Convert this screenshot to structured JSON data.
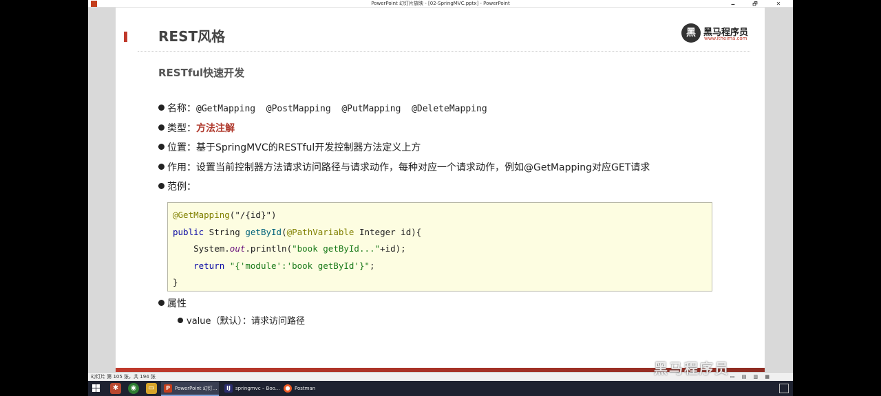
{
  "window": {
    "title": "PowerPoint 幻灯片放映 - [02-SpringMVC.pptx] - PowerPoint",
    "minimize": "🗕",
    "maximize": "🗗",
    "close": "✕"
  },
  "slide": {
    "title": "REST风格",
    "logo": {
      "mark": "黑",
      "text": "黑马程序员",
      "url": "www.itheima.com"
    },
    "subtitle": "RESTful快速开发",
    "bullets": {
      "name_label": "名称：",
      "name_value": "@GetMapping  @PostMapping  @PutMapping  @DeleteMapping",
      "type_label": "类型：",
      "type_value": "方法注解",
      "position_label": "位置：",
      "position_value": "基于SpringMVC的RESTful开发控制器方法定义上方",
      "effect_label": "作用：",
      "effect_value": "设置当前控制器方法请求访问路径与请求动作，每种对应一个请求动作，例如@GetMapping对应GET请求",
      "example_label": "范例："
    },
    "code": {
      "l1_anno": "@GetMapping",
      "l1_rest": "(\"/{id}\")",
      "l2_kw": "public",
      "l2_a": " String ",
      "l2_m": "getById",
      "l2_b": "(",
      "l2_anno": "@PathVariable",
      "l2_c": " Integer id){",
      "l3_a": "    System.",
      "l3_out": "out",
      "l3_b": ".println(",
      "l3_str": "\"book getById...\"",
      "l3_c": "+id);",
      "l4_a": "    ",
      "l4_kw": "return",
      "l4_b": " ",
      "l4_str": "\"{'module':'book getById'}\"",
      "l4_c": ";",
      "l5": "}"
    },
    "attr_label": "属性",
    "attr_item": "value（默认）：请求访问路径"
  },
  "statusbar": {
    "slide_count": "幻灯片 第 105 张，共 194 张",
    "view_icons": "▭ ▤ ▥ ▦"
  },
  "watermark": "黑马程序员",
  "taskbar": {
    "tasks": [
      {
        "icon": "P",
        "label": "PowerPoint 幻灯...",
        "color": "#c43e1c"
      },
      {
        "icon": "IJ",
        "label": "springmvc – Boo...",
        "color": "#2b2d6e"
      },
      {
        "icon": "●",
        "label": "Postman",
        "color": "#ef5b25"
      }
    ]
  }
}
